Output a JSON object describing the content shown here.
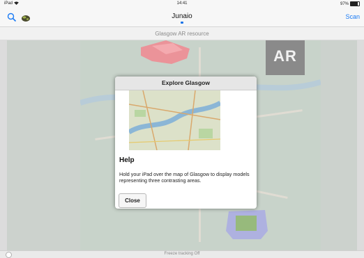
{
  "status_bar": {
    "device": "iPad",
    "time": "14:41",
    "battery": "97%"
  },
  "nav": {
    "title": "Junaio",
    "scan_label": "Scan"
  },
  "resource": {
    "title": "Glasgow AR resource"
  },
  "camera": {
    "marker_text": "AR"
  },
  "dialog": {
    "title": "Explore Glasgow",
    "help_heading": "Help",
    "help_text": "Hold your iPad over the map of Glasgow to display models representing three contrasting areas.",
    "close_label": "Close"
  },
  "footer": {
    "text": "Freeze tracking Off"
  },
  "colors": {
    "accent": "#1a7bf5",
    "model_red": "#e46a72",
    "model_blue": "#8f94d4"
  },
  "icons": {
    "search": "search-icon",
    "globe": "globe-icon",
    "wifi": "wifi-icon",
    "battery": "battery-icon"
  }
}
